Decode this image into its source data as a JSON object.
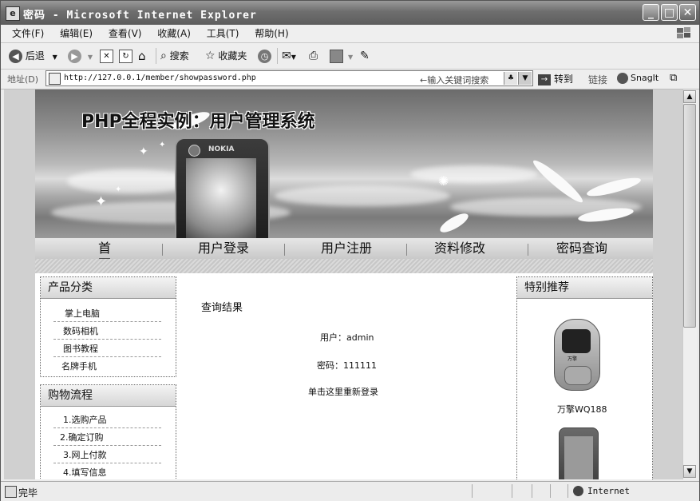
{
  "window": {
    "title": "密码 - Microsoft Internet Explorer",
    "icon_glyph": "e",
    "minimize": "_",
    "maximize": "□",
    "close": "✕"
  },
  "menu": [
    "文件(F)",
    "编辑(E)",
    "查看(V)",
    "收藏(A)",
    "工具(T)",
    "帮助(H)"
  ],
  "toolbar": {
    "back": "后退",
    "search": "搜索",
    "favorites": "收藏夹"
  },
  "address": {
    "label": "地址(D)",
    "url": "http://127.0.0.1/member/showpassword.php",
    "hint": "←输入关键词搜索",
    "go": "转到",
    "links": "链接",
    "snagit": "SnagIt"
  },
  "page": {
    "banner_title": "PHP全程实例：用户管理系统",
    "phone_brand": "NOKIA",
    "nav": [
      "首　　页",
      "用户登录",
      "用户注册",
      "资料修改",
      "密码查询"
    ],
    "left_boxes": [
      {
        "title": "产品分类",
        "items": [
          "掌上电脑",
          "数码相机",
          "图书教程",
          "名牌手机"
        ]
      },
      {
        "title": "购物流程",
        "items": [
          "1.选购产品",
          "2.确定订购",
          "3.网上付款",
          "4.填写信息"
        ]
      }
    ],
    "main": {
      "heading": "查询结果",
      "user_line": "用户：admin",
      "password_line": "密码：111111",
      "relogin": "单击这里重新登录"
    },
    "right_box": {
      "title": "特别推荐",
      "product_name": "万擎WQ188",
      "product_brand": "万擎"
    }
  },
  "status": {
    "text": "完毕",
    "zone": "Internet"
  }
}
